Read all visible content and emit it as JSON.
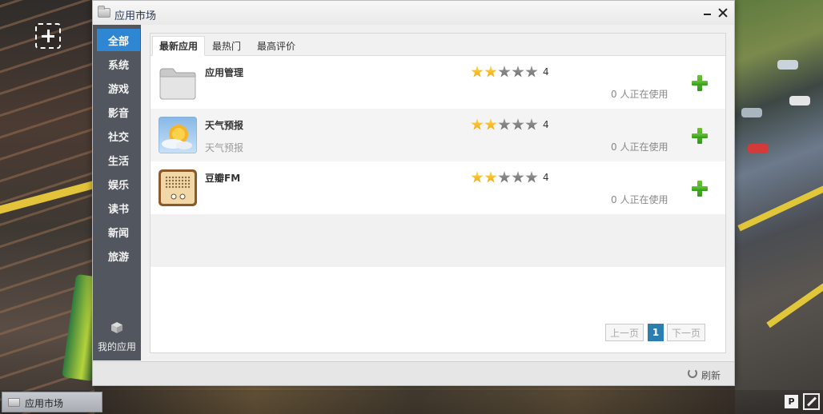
{
  "window": {
    "title": "应用市场",
    "minimize_icon": "minimize-icon",
    "close_icon": "close-icon"
  },
  "sidebar": {
    "categories": [
      {
        "label": "全部",
        "active": true
      },
      {
        "label": "系统",
        "active": false
      },
      {
        "label": "游戏",
        "active": false
      },
      {
        "label": "影音",
        "active": false
      },
      {
        "label": "社交",
        "active": false
      },
      {
        "label": "生活",
        "active": false
      },
      {
        "label": "娱乐",
        "active": false
      },
      {
        "label": "读书",
        "active": false
      },
      {
        "label": "新闻",
        "active": false
      },
      {
        "label": "旅游",
        "active": false
      }
    ],
    "my_apps": {
      "label": "我的应用",
      "icon": "cube-icon"
    },
    "active_color": "#2f86d3"
  },
  "tabs": [
    {
      "label": "最新应用",
      "active": true
    },
    {
      "label": "最热门",
      "active": false
    },
    {
      "label": "最高评价",
      "active": false
    }
  ],
  "apps": [
    {
      "name": "应用管理",
      "desc": "",
      "rating": 2,
      "rating_max": 5,
      "rating_text": "4",
      "users": "0 人正在使用",
      "icon": "folder-icon"
    },
    {
      "name": "天气预报",
      "desc": "天气预报",
      "rating": 2,
      "rating_max": 5,
      "rating_text": "4",
      "users": "0 人正在使用",
      "icon": "weather-sun-icon"
    },
    {
      "name": "豆瓣FM",
      "desc": "",
      "rating": 2,
      "rating_max": 5,
      "rating_text": "4",
      "users": "0 人正在使用",
      "icon": "radio-icon"
    }
  ],
  "pager": {
    "prev": "上一页",
    "current": "1",
    "next": "下一页",
    "current_color": "#2a7fb0"
  },
  "footer": {
    "refresh": "刷新",
    "refresh_icon": "refresh-icon"
  },
  "taskbar": {
    "item_label": "应用市场",
    "item_icon": "window-icon",
    "tray_ime": "P",
    "tray_showdesk_icon": "show-desktop-icon"
  },
  "desktop": {
    "add_icon": "add-app-icon"
  }
}
